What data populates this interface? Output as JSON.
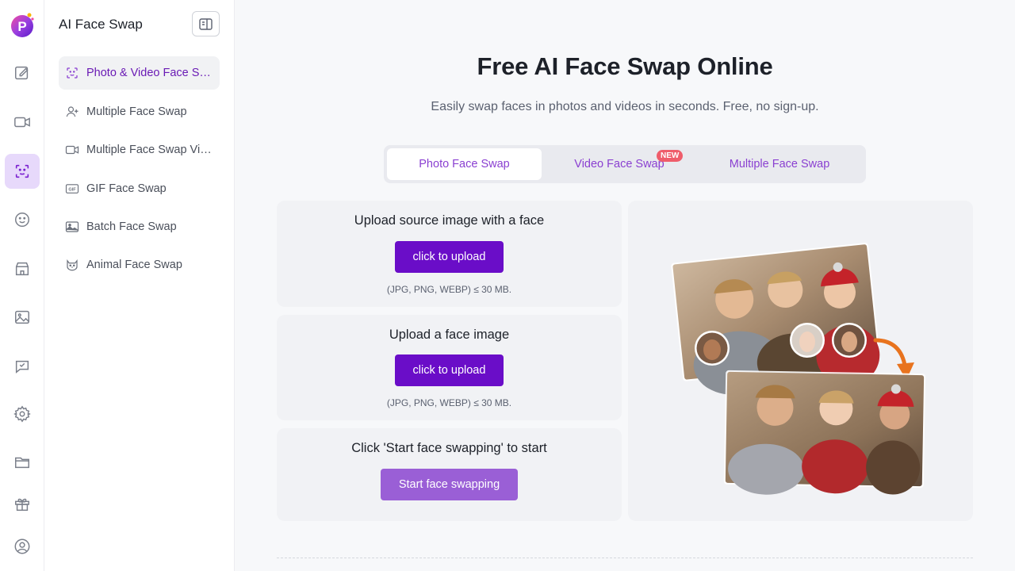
{
  "rail": {
    "logo_letter": "P",
    "items": [
      {
        "name": "edit",
        "icon": "edit-icon"
      },
      {
        "name": "video",
        "icon": "video-camera-icon"
      },
      {
        "name": "face-swap",
        "icon": "face-swap-icon",
        "active": true
      },
      {
        "name": "emoji",
        "icon": "smiley-icon"
      },
      {
        "name": "store",
        "icon": "store-icon"
      },
      {
        "name": "image",
        "icon": "image-icon"
      },
      {
        "name": "chat",
        "icon": "chat-icon"
      },
      {
        "name": "settings",
        "icon": "gear-icon"
      },
      {
        "name": "folder",
        "icon": "folder-icon"
      },
      {
        "name": "gift",
        "icon": "gift-icon"
      },
      {
        "name": "account",
        "icon": "user-circle-icon"
      }
    ]
  },
  "sidebar": {
    "title": "AI Face Swap",
    "items": [
      {
        "label": "Photo & Video Face Swap",
        "icon": "face-frame-icon",
        "active": true
      },
      {
        "label": "Multiple Face Swap",
        "icon": "add-user-icon"
      },
      {
        "label": "Multiple Face Swap Video",
        "icon": "video-camera-icon"
      },
      {
        "label": "GIF Face Swap",
        "icon": "gif-icon"
      },
      {
        "label": "Batch Face Swap",
        "icon": "photos-icon"
      },
      {
        "label": "Animal Face Swap",
        "icon": "cat-icon"
      }
    ]
  },
  "main": {
    "title": "Free AI Face Swap Online",
    "subtitle": "Easily swap faces in photos and videos in seconds. Free, no sign-up.",
    "tabs": [
      {
        "label": "Photo Face Swap",
        "active": true
      },
      {
        "label": "Video Face Swap",
        "badge": "NEW"
      },
      {
        "label": "Multiple Face Swap"
      }
    ],
    "cards": [
      {
        "title": "Upload source image with a face",
        "button": "click to upload",
        "hint": "(JPG, PNG, WEBP) ≤ 30 MB."
      },
      {
        "title": "Upload a face image",
        "button": "click to upload",
        "hint": "(JPG, PNG, WEBP) ≤ 30 MB."
      },
      {
        "title": "Click 'Start face swapping' to start",
        "button": "Start face swapping"
      }
    ]
  },
  "colors": {
    "accent": "#6a0dc8",
    "accent_light": "#9a5fd6",
    "tab_text": "#8a3fd1",
    "badge": "#ef5d6b",
    "arrow": "#e8731e"
  }
}
